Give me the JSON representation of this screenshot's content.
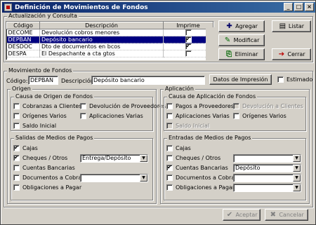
{
  "window": {
    "title": "Definición de Movimientos de Fondos",
    "minimize": "_",
    "maximize": "□",
    "close": "×"
  },
  "consulta": {
    "title": "Actualización y Consulta",
    "columns": [
      "Código",
      "Descripción",
      "Imprime"
    ],
    "rows": [
      {
        "code": "DECOME",
        "desc": "Devolución cobros menores",
        "imprime": false,
        "selected": false
      },
      {
        "code": "DEPBAN",
        "desc": "Depósito bancario",
        "imprime": true,
        "selected": true
      },
      {
        "code": "DESDOC",
        "desc": "Dto de documentos en bcos",
        "imprime": true,
        "selected": false
      },
      {
        "code": "DESPA",
        "desc": "El Despachante a cta gtos",
        "imprime": false,
        "selected": false
      }
    ],
    "buttons": {
      "agregar": "Agregar",
      "listar": "Listar",
      "modificar": "Modificar",
      "eliminar": "Eliminar",
      "cerrar": "Cerrar"
    }
  },
  "movimiento": {
    "title": "Movimiento de Fondos",
    "codigo_label": "Código:",
    "codigo_value": "DEPBAN",
    "descripcion_label": "Descripción:",
    "descripcion_value": "Depósito bancario",
    "datos_impresion": "Datos de Impresión",
    "estimado": "Estimado"
  },
  "origen": {
    "title": "Origen",
    "causa_title": "Causa de Origen de Fondos",
    "causa": {
      "cobranzas": "Cobranzas a Clientes",
      "devolucion_prov": "Devolución de Proveedores",
      "origenes_varios": "Orígenes Varios",
      "aplicaciones_varias": "Aplicaciones Varias",
      "saldo_inicial": "Saldo Inicial"
    },
    "salidas_title": "Salidas de Medios de Pagos",
    "salidas": {
      "cajas": "Cajas",
      "cheques": "Cheques / Otros",
      "cheques_value": "Entrega/Depósito",
      "cuentas": "Cuentas Bancarias",
      "documentos": "Documentos a Cobrar",
      "obligaciones": "Obligaciones a Pagar"
    }
  },
  "aplicacion": {
    "title": "Aplicación",
    "causa_title": "Causa de Aplicación de Fondos",
    "causa": {
      "pagos": "Pagos a Proveedores",
      "devolucion_cli": "Devolución a Clientes",
      "aplicaciones_varias": "Aplicaciones Varias",
      "origenes_varios": "Orígenes Varios",
      "saldo_inicial": "Saldo Inicial"
    },
    "entradas_title": "Entradas de Medios de Pagos",
    "entradas": {
      "cajas": "Cajas",
      "cheques": "Cheques / Otros",
      "cuentas": "Cuentas Bancarias",
      "cuentas_value": "Depósito",
      "documentos": "Documentos a Cobrar",
      "obligaciones": "Obligaciones a Pagar"
    }
  },
  "footer": {
    "aceptar": "Aceptar",
    "cancelar": "Cancelar"
  }
}
